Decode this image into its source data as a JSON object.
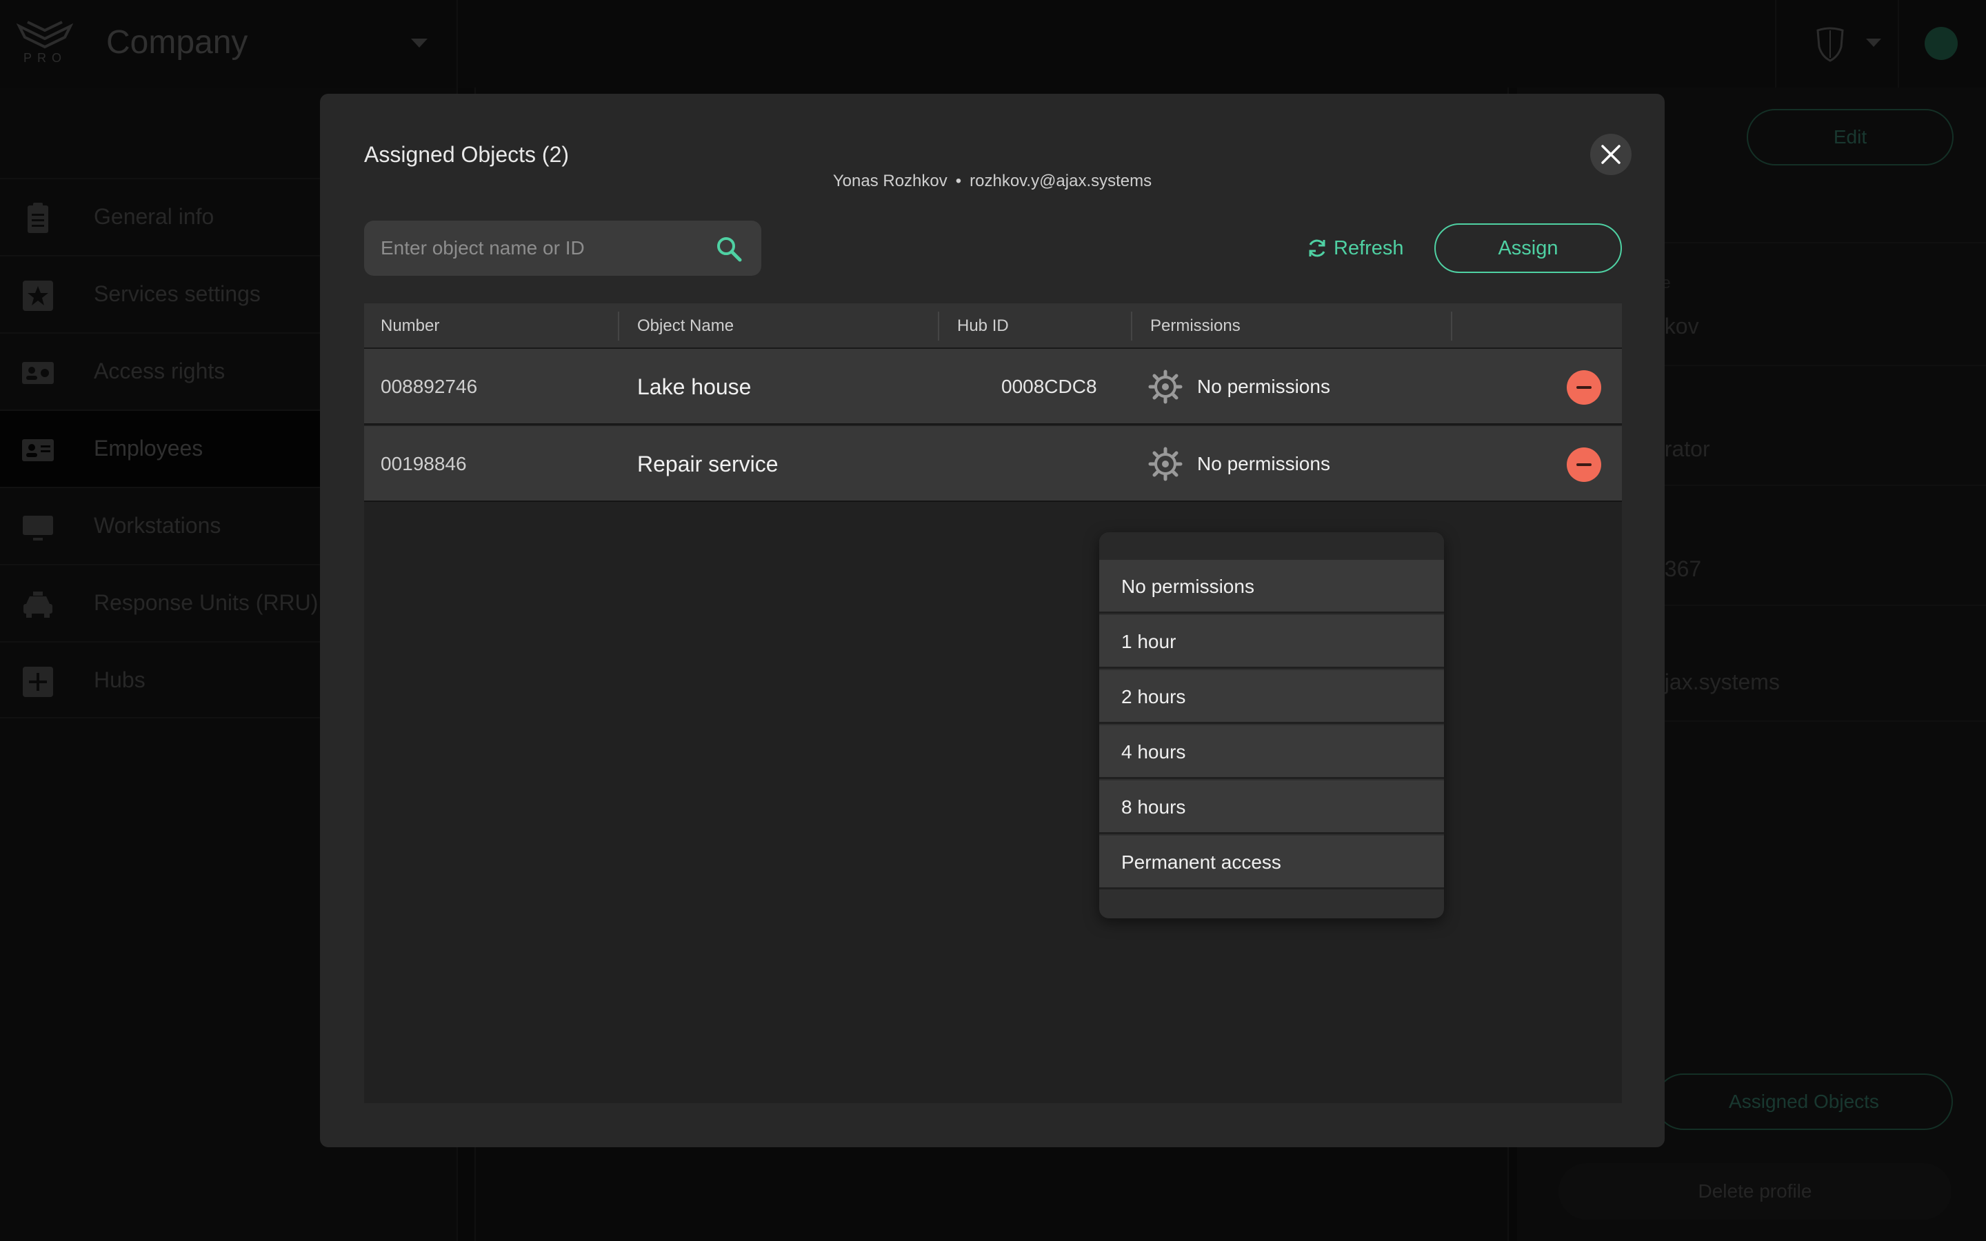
{
  "app": {
    "logo_text": "PRO",
    "company": "Company"
  },
  "sidebar": {
    "items": [
      {
        "label": "General info",
        "icon": "clipboard-icon"
      },
      {
        "label": "Services settings",
        "icon": "star-icon"
      },
      {
        "label": "Access rights",
        "icon": "id-card-gear-icon"
      },
      {
        "label": "Employees",
        "icon": "id-card-icon",
        "active": true
      },
      {
        "label": "Workstations",
        "icon": "monitor-icon"
      },
      {
        "label": "Response Units (RRU)",
        "icon": "car-icon"
      },
      {
        "label": "Hubs",
        "icon": "plus-box-icon"
      }
    ]
  },
  "profile": {
    "edit_label": "Edit",
    "name_label_fragment": "ne",
    "name_fragment": "hkov",
    "role_fragment": "erator",
    "phone_fragment": "6367",
    "email_fragment": "ajax.systems",
    "assigned_objects_label": "Assigned Objects",
    "delete_label": "Delete profile"
  },
  "modal": {
    "title": "Assigned Objects (2)",
    "user_name": "Yonas Rozhkov",
    "separator": "•",
    "user_email": "rozhkov.y@ajax.systems",
    "search": {
      "placeholder": "Enter object name or ID",
      "value": ""
    },
    "refresh_label": "Refresh",
    "assign_label": "Assign",
    "columns": [
      "Number",
      "Object Name",
      "Hub ID",
      "Permissions"
    ],
    "rows": [
      {
        "number": "008892746",
        "name": "Lake house",
        "hub_id": "0008CDC8",
        "permission": "No permissions"
      },
      {
        "number": "00198846",
        "name": "Repair service",
        "hub_id": "",
        "permission": "No permissions"
      }
    ]
  },
  "permissions_dropdown": {
    "options": [
      "No permissions",
      "1 hour",
      "2 hours",
      "4 hours",
      "8 hours",
      "Permanent access"
    ]
  },
  "colors": {
    "accent": "#4fd1a3",
    "danger": "#f26b57",
    "modal_bg": "#282828"
  }
}
